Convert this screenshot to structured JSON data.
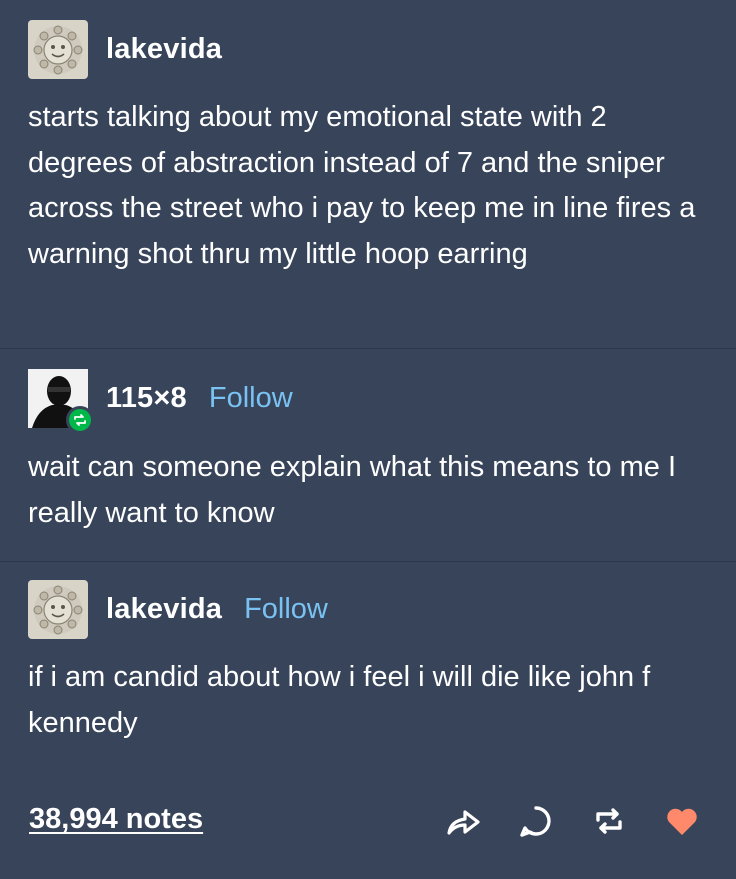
{
  "posts": [
    {
      "username": "lakevida",
      "follow_label": "",
      "text": "starts talking about my emotional state with 2 degrees of abstraction instead of 7 and the sniper across the street who i pay to keep me in line fires a warning shot thru my little hoop earring"
    },
    {
      "username": "115×8",
      "follow_label": "Follow",
      "text": "wait can someone explain what this means to me I really want to know"
    },
    {
      "username": "lakevida",
      "follow_label": "Follow",
      "text": "if i am candid about how i feel i will die like john f kennedy"
    }
  ],
  "footer": {
    "notes_label": "38,994 notes",
    "actions": [
      "share-icon",
      "reply-icon",
      "reblog-icon",
      "like-icon"
    ]
  },
  "colors": {
    "background": "#37445a",
    "link": "#79c2f2",
    "reblog_green": "#00b84a",
    "like_orange": "#ff8a6b"
  }
}
